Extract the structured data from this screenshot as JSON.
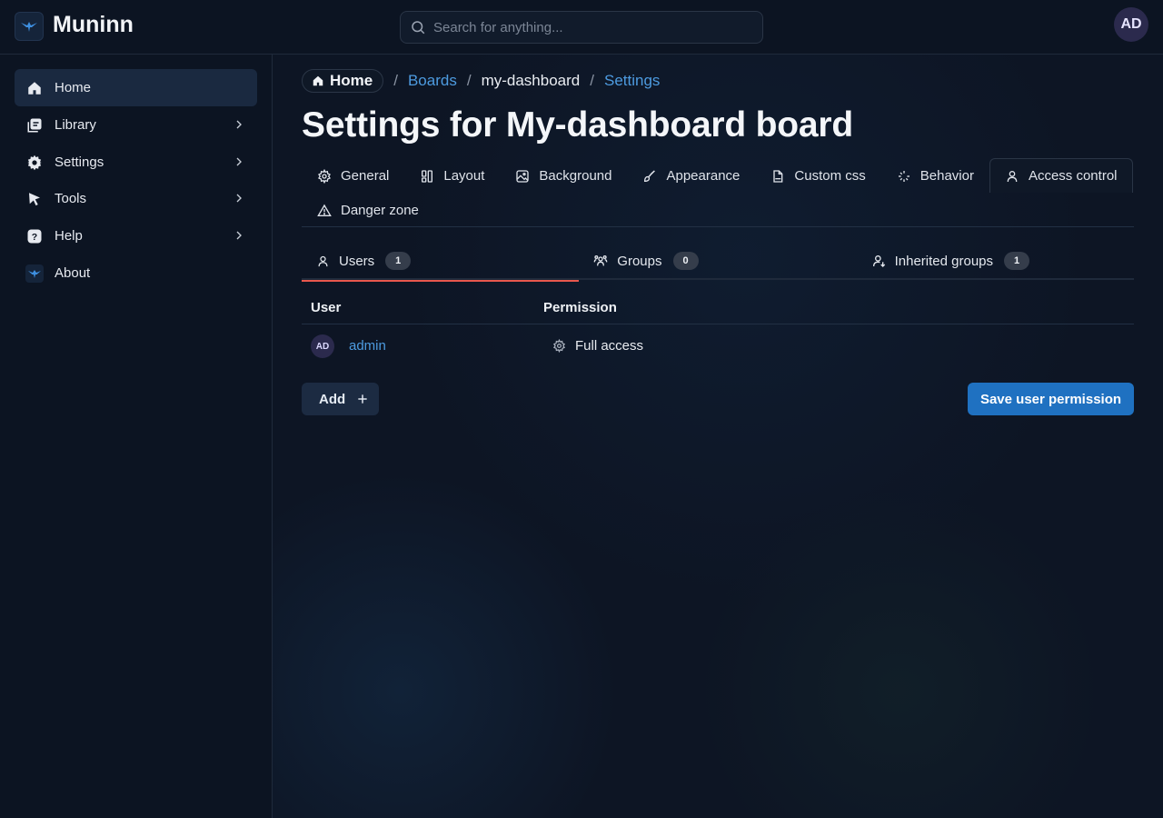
{
  "app": {
    "title": "Muninn",
    "logo_icon": "raven-logo-icon"
  },
  "search": {
    "placeholder": "Search for anything..."
  },
  "user": {
    "initials": "AD"
  },
  "sidebar": {
    "items": [
      {
        "label": "Home",
        "icon": "home-icon",
        "active": true
      },
      {
        "label": "Library",
        "icon": "library-icon",
        "expandable": true
      },
      {
        "label": "Settings",
        "icon": "gear-icon",
        "expandable": true
      },
      {
        "label": "Tools",
        "icon": "pointer-icon",
        "expandable": true
      },
      {
        "label": "Help",
        "icon": "help-icon",
        "expandable": true
      },
      {
        "label": "About",
        "icon": "raven-logo-icon"
      }
    ]
  },
  "breadcrumb": {
    "home": "Home",
    "separator": "/",
    "items": [
      "Boards",
      "my-dashboard",
      "Settings"
    ]
  },
  "page": {
    "title": "Settings for My-dashboard board"
  },
  "tabs": [
    {
      "label": "General",
      "icon": "gear-icon"
    },
    {
      "label": "Layout",
      "icon": "layout-icon"
    },
    {
      "label": "Background",
      "icon": "image-icon"
    },
    {
      "label": "Appearance",
      "icon": "brush-icon"
    },
    {
      "label": "Custom css",
      "icon": "css-file-icon"
    },
    {
      "label": "Behavior",
      "icon": "sparkle-icon"
    },
    {
      "label": "Access control",
      "icon": "user-icon",
      "active": true
    },
    {
      "label": "Danger zone",
      "icon": "warning-icon"
    }
  ],
  "sub_tabs": [
    {
      "label": "Users",
      "count": "1",
      "icon": "user-icon",
      "active": true
    },
    {
      "label": "Groups",
      "count": "0",
      "icon": "users-group-icon"
    },
    {
      "label": "Inherited groups",
      "count": "1",
      "icon": "user-down-icon"
    }
  ],
  "table": {
    "headers": {
      "user": "User",
      "permission": "Permission"
    },
    "rows": [
      {
        "avatar": "AD",
        "name": "admin",
        "permission": "Full access",
        "permission_icon": "gear-icon"
      }
    ]
  },
  "actions": {
    "add_label": "Add",
    "save_label": "Save user permission"
  },
  "colors": {
    "accent": "#1f71c1",
    "link": "#4d9be0",
    "active_tab_underline": "#e8574d",
    "background": "#0d1524"
  }
}
